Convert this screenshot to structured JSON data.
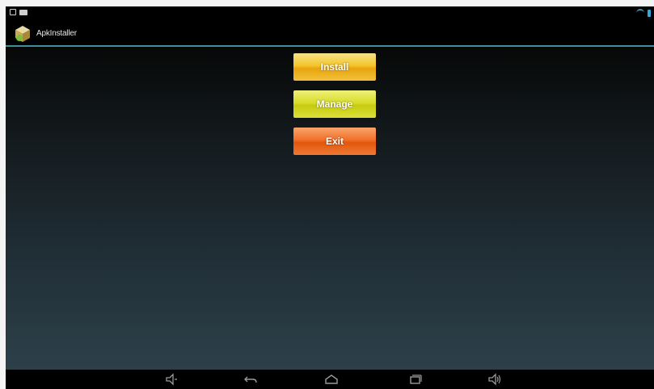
{
  "app": {
    "title": "ApkInstaller"
  },
  "buttons": {
    "install": "Install",
    "manage": "Manage",
    "exit": "Exit"
  },
  "icons": {
    "status_left": [
      "notification-icon",
      "image-notification-icon"
    ],
    "status_right": [
      "wifi-icon",
      "battery-icon"
    ],
    "app": "apk-installer-app-icon",
    "nav": [
      "volume-down-icon",
      "back-icon",
      "home-icon",
      "recent-apps-icon",
      "volume-up-icon"
    ]
  },
  "colors": {
    "accent_divider": "#3f8ea4",
    "install_button": "#f4c52a",
    "manage_button": "#d8dd2a",
    "exit_button": "#f0712a"
  }
}
